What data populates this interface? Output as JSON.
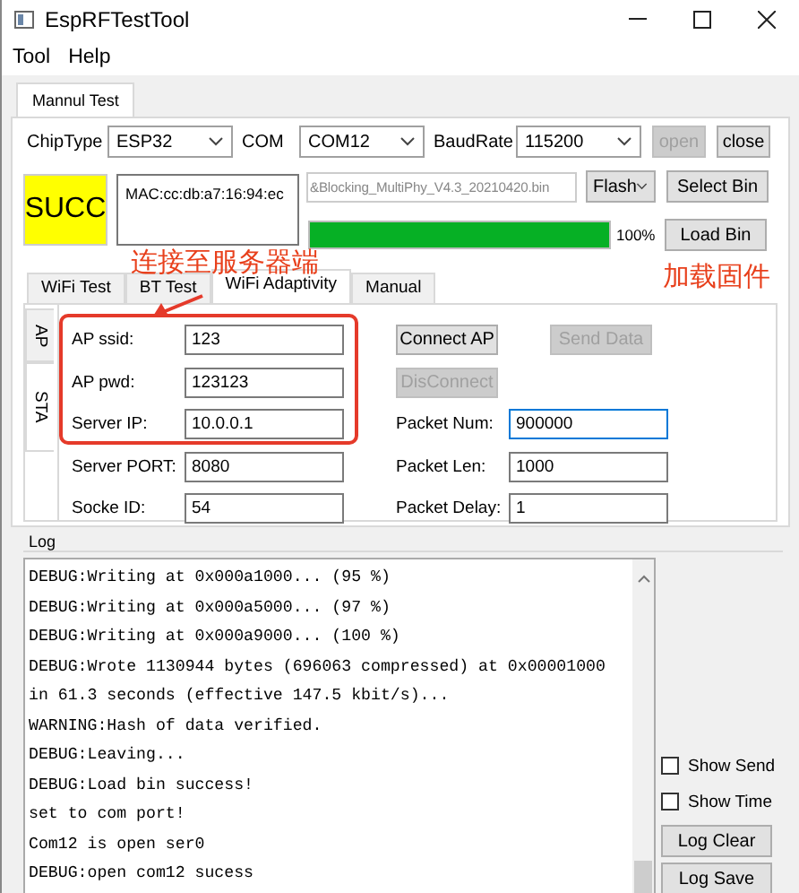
{
  "window": {
    "title": "EspRFTestTool"
  },
  "menu": [
    "Tool",
    "Help"
  ],
  "main_tabs": [
    {
      "label": "Mannul Test",
      "selected": true
    }
  ],
  "connection": {
    "fields": [
      {
        "label": "ChipType",
        "value": "ESP32"
      },
      {
        "label": "COM",
        "value": "COM12"
      },
      {
        "label": "BaudRate",
        "value": "115200"
      }
    ],
    "buttons": [
      {
        "label": "open",
        "disabled": true
      },
      {
        "label": "close",
        "disabled": false
      }
    ]
  },
  "status": "SUCC",
  "mac": "MAC:cc:db:a7:16:94:ec",
  "bin_path": "&Blocking_MultiPhy_V4.3_20210420.bin",
  "flash_mode": "Flash",
  "select_bin": "Select Bin",
  "progress": {
    "level": 1,
    "reading": "100%"
  },
  "load_bin": "Load Bin",
  "sub_tabs": [
    {
      "label": "WiFi Test",
      "selected": false
    },
    {
      "label": "BT Test",
      "selected": false
    },
    {
      "label": "WiFi Adaptivity",
      "selected": true
    },
    {
      "label": "Manual",
      "selected": false
    }
  ],
  "side_tabs": [
    {
      "label": "AP",
      "selected": false
    },
    {
      "label": "STA",
      "selected": true
    }
  ],
  "sta_fields": [
    {
      "label": "AP ssid:",
      "value": "123"
    },
    {
      "label": "AP pwd:",
      "value": "123123"
    },
    {
      "label": "Server IP:",
      "value": "10.0.0.1"
    },
    {
      "label": "Server PORT:",
      "value": "8080"
    },
    {
      "label": "Socke ID:",
      "value": "54"
    }
  ],
  "actions": [
    {
      "label": "Connect AP",
      "disabled": false
    },
    {
      "label": "Send Data",
      "disabled": true
    },
    {
      "label": "DisConnect",
      "disabled": true
    }
  ],
  "packet_fields": [
    {
      "label": "Packet Num:",
      "value": "900000",
      "focused": true
    },
    {
      "label": "Packet Len:",
      "value": "1000",
      "focused": false
    },
    {
      "label": "Packet Delay:",
      "value": "1",
      "focused": false
    }
  ],
  "log": {
    "title": "Log",
    "lines": [
      "DEBUG:Writing at 0x000a1000... (95 %)",
      "DEBUG:Writing at 0x000a5000... (97 %)",
      "DEBUG:Writing at 0x000a9000... (100 %)",
      "DEBUG:Wrote 1130944 bytes (696063 compressed) at 0x00001000",
      "in 61.3 seconds (effective 147.5 kbit/s)...",
      "WARNING:Hash of data verified.",
      "DEBUG:Leaving...",
      "DEBUG:Load bin success!",
      "set to com port!",
      "Com12 is open ser0",
      "DEBUG:open com12 sucess"
    ]
  },
  "log_options": [
    {
      "label": "Show Send",
      "checked": false
    },
    {
      "label": "Show Time",
      "checked": false
    }
  ],
  "log_buttons": [
    "Log Clear",
    "Log Save"
  ],
  "annotations": [
    "连接至服务器端",
    "加载固件"
  ]
}
